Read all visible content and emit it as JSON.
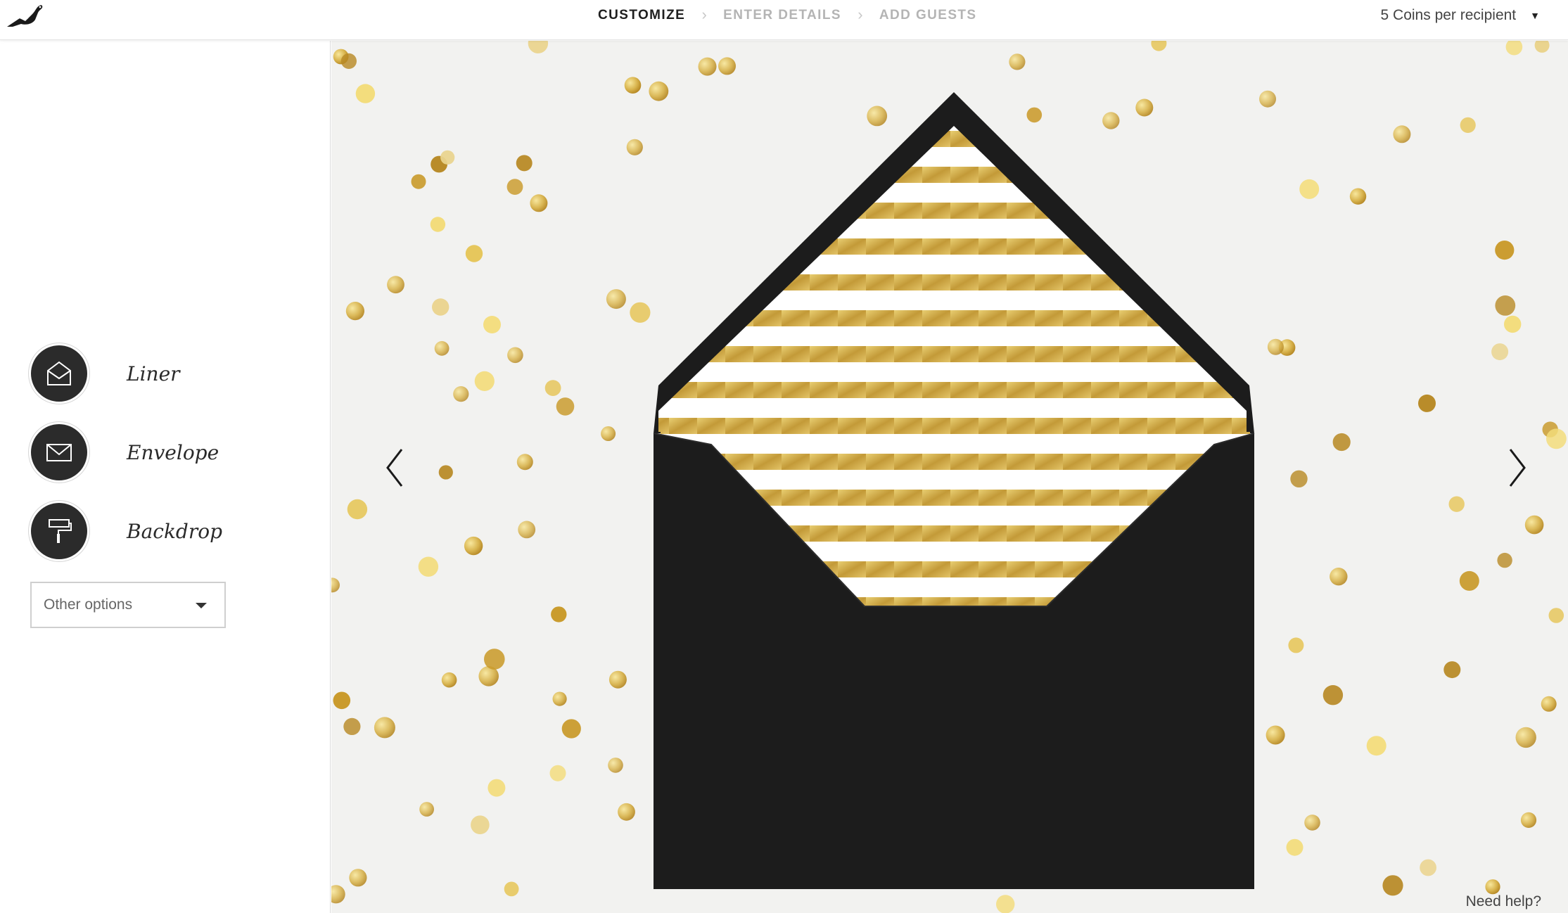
{
  "header": {
    "logo": "bird-logo",
    "steps": [
      {
        "label": "CUSTOMIZE",
        "active": true
      },
      {
        "label": "ENTER DETAILS",
        "active": false
      },
      {
        "label": "ADD GUESTS",
        "active": false
      }
    ],
    "step_separator": "›",
    "coins_label": "5 Coins per recipient",
    "coins_caret": "▼"
  },
  "sidebar": {
    "options": [
      {
        "label": "Liner",
        "icon": "envelope-open-icon"
      },
      {
        "label": "Envelope",
        "icon": "envelope-icon"
      },
      {
        "label": "Backdrop",
        "icon": "paint-roller-icon"
      }
    ],
    "other_options": {
      "label": "Other options"
    }
  },
  "stage": {
    "background": "#f2f2f0",
    "envelope_color": "#1c1c1c",
    "liner_stripe_color": "#c9a64d",
    "liner_base_color": "#ffffff",
    "confetti_colors": [
      "#e6c65a",
      "#c99a2a",
      "#f3dc7a",
      "#b88a26",
      "#ead48e"
    ],
    "prev_icon": "chevron-left-icon",
    "next_icon": "chevron-right-icon",
    "help_label": "Need help?"
  }
}
